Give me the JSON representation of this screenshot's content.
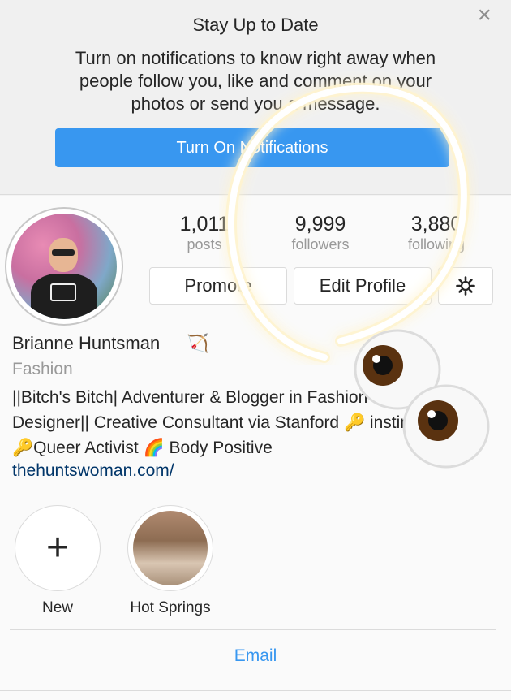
{
  "notification": {
    "close_icon": "×",
    "title": "Stay Up to Date",
    "body": "Turn on notifications to know right away when people follow you, like and comment on your photos or send you a message.",
    "button_label": "Turn On Notifications"
  },
  "profile": {
    "stats": [
      {
        "value": "1,011",
        "label": "posts"
      },
      {
        "value": "9,999",
        "label": "followers"
      },
      {
        "value": "3,880",
        "label": "following"
      }
    ],
    "promote_label": "Promote",
    "edit_profile_label": "Edit Profile",
    "settings_icon": "gear-icon",
    "name": "Brianne Huntsman",
    "name_emoji": "🏹",
    "category": "Fashion",
    "bio": "||Bitch's Bitch| Adventurer & Blogger in Fashion Designer|| Creative Consultant via Stanford 🔑 instincts🔑Queer Activist 🌈 Body Positive",
    "website": "thehuntswoman.com/"
  },
  "highlights": [
    {
      "label": "New",
      "icon": "plus-icon"
    },
    {
      "label": "Hot Springs",
      "icon": "story-thumbnail"
    }
  ],
  "footer": {
    "email_label": "Email"
  },
  "colors": {
    "accent": "#3897f0",
    "link": "#003569",
    "muted": "#999999"
  }
}
